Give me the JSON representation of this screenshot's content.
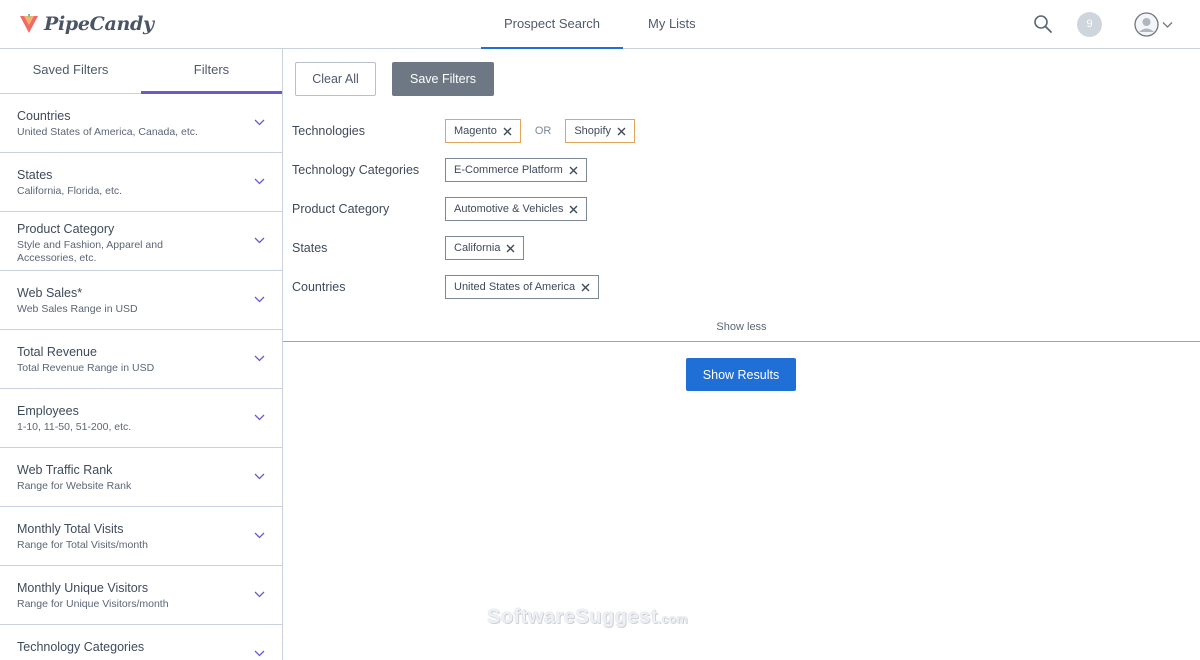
{
  "app": {
    "logo_text": "PipeCandy",
    "brand_color": "#1f6fd6"
  },
  "nav": {
    "tabs": [
      {
        "label": "Prospect Search",
        "active": true
      },
      {
        "label": "My Lists",
        "active": false
      }
    ]
  },
  "header": {
    "notification_count": "9",
    "search_icon": "search-icon",
    "avatar_icon": "user-avatar-icon"
  },
  "sidebar": {
    "tabs": [
      {
        "label": "Saved Filters",
        "active": false
      },
      {
        "label": "Filters",
        "active": true
      }
    ],
    "filters": [
      {
        "title": "Countries",
        "subtitle": "United States of America, Canada, etc."
      },
      {
        "title": "States",
        "subtitle": "California, Florida, etc."
      },
      {
        "title": "Product Category",
        "subtitle": "Style and Fashion, Apparel and Accessories, etc."
      },
      {
        "title": "Web Sales*",
        "subtitle": "Web Sales Range in USD"
      },
      {
        "title": "Total Revenue",
        "subtitle": "Total Revenue Range in USD"
      },
      {
        "title": "Employees",
        "subtitle": "1-10, 11-50, 51-200, etc."
      },
      {
        "title": "Web Traffic Rank",
        "subtitle": "Range for Website Rank"
      },
      {
        "title": "Monthly Total Visits",
        "subtitle": "Range for Total Visits/month"
      },
      {
        "title": "Monthly Unique Visitors",
        "subtitle": "Range for Unique Visitors/month"
      },
      {
        "title": "Technology Categories",
        "subtitle": ""
      }
    ]
  },
  "main": {
    "clear_all_label": "Clear All",
    "save_filters_label": "Save Filters",
    "applied_filters": [
      {
        "label": "Technologies",
        "chips": [
          "Magento",
          "Shopify"
        ],
        "separator": "OR"
      },
      {
        "label": "Technology Categories",
        "chips": [
          "E-Commerce Platform"
        ]
      },
      {
        "label": "Product Category",
        "chips": [
          "Automotive & Vehicles"
        ]
      },
      {
        "label": "States",
        "chips": [
          "California"
        ]
      },
      {
        "label": "Countries",
        "chips": [
          "United States of America"
        ]
      }
    ],
    "show_less_label": "Show less",
    "show_results_label": "Show Results"
  },
  "watermark": {
    "text": "SoftwareSuggest",
    "suffix": ".com"
  }
}
